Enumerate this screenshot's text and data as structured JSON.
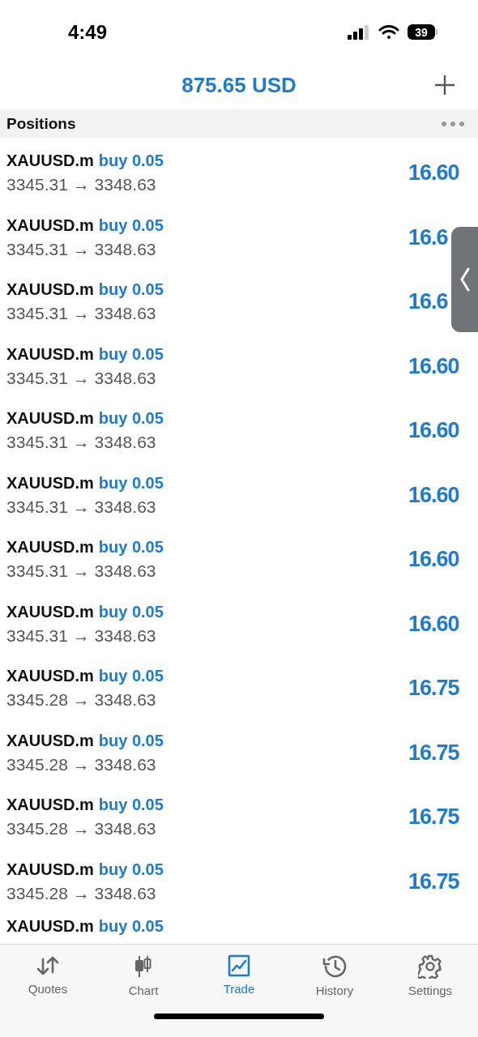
{
  "status_bar": {
    "time": "4:49",
    "battery": "39"
  },
  "header": {
    "balance": "875.65 USD"
  },
  "section": {
    "title": "Positions"
  },
  "positions": [
    {
      "symbol": "XAUUSD.m",
      "order": "buy 0.05",
      "prices": "3345.31 → 3348.63",
      "profit": "16.60"
    },
    {
      "symbol": "XAUUSD.m",
      "order": "buy 0.05",
      "prices": "3345.31 → 3348.63",
      "profit": "16.6"
    },
    {
      "symbol": "XAUUSD.m",
      "order": "buy 0.05",
      "prices": "3345.31 → 3348.63",
      "profit": "16.6"
    },
    {
      "symbol": "XAUUSD.m",
      "order": "buy 0.05",
      "prices": "3345.31 → 3348.63",
      "profit": "16.60"
    },
    {
      "symbol": "XAUUSD.m",
      "order": "buy 0.05",
      "prices": "3345.31 → 3348.63",
      "profit": "16.60"
    },
    {
      "symbol": "XAUUSD.m",
      "order": "buy 0.05",
      "prices": "3345.31 → 3348.63",
      "profit": "16.60"
    },
    {
      "symbol": "XAUUSD.m",
      "order": "buy 0.05",
      "prices": "3345.31 → 3348.63",
      "profit": "16.60"
    },
    {
      "symbol": "XAUUSD.m",
      "order": "buy 0.05",
      "prices": "3345.31 → 3348.63",
      "profit": "16.60"
    },
    {
      "symbol": "XAUUSD.m",
      "order": "buy 0.05",
      "prices": "3345.28 → 3348.63",
      "profit": "16.75"
    },
    {
      "symbol": "XAUUSD.m",
      "order": "buy 0.05",
      "prices": "3345.28 → 3348.63",
      "profit": "16.75"
    },
    {
      "symbol": "XAUUSD.m",
      "order": "buy 0.05",
      "prices": "3345.28 → 3348.63",
      "profit": "16.75"
    },
    {
      "symbol": "XAUUSD.m",
      "order": "buy 0.05",
      "prices": "3345.28 → 3348.63",
      "profit": "16.75"
    },
    {
      "symbol": "XAUUSD.m",
      "order": "buy 0.05"
    }
  ],
  "tabs": [
    {
      "label": "Quotes",
      "selected": false
    },
    {
      "label": "Chart",
      "selected": false
    },
    {
      "label": "Trade",
      "selected": true
    },
    {
      "label": "History",
      "selected": false
    },
    {
      "label": "Settings",
      "selected": false
    }
  ]
}
